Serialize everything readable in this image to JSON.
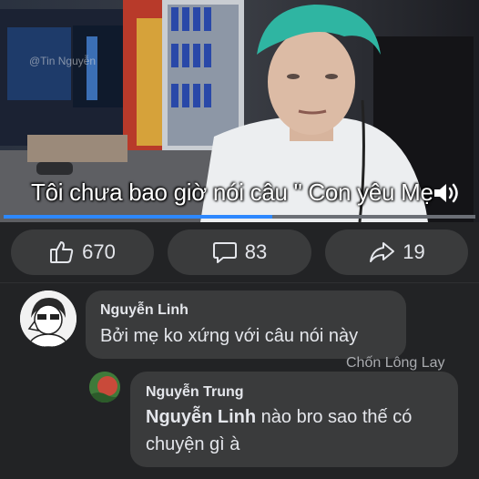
{
  "video": {
    "watermark": "@Tin Nguyễn",
    "subtitle": "Tôi chưa bao giờ nói câu \" Con yêu Mẹ",
    "progress_fraction": 0.57,
    "volume_icon": "speaker-icon"
  },
  "actions": {
    "like_count": "670",
    "comment_count": "83",
    "share_count": "19",
    "like_icon": "thumbs-up-icon",
    "comment_icon": "speech-bubble-icon",
    "share_icon": "share-arrow-icon"
  },
  "comments": [
    {
      "author": "Nguyễn Linh",
      "text": "Bởi mẹ ko xứng với câu nói này"
    }
  ],
  "reply": {
    "author": "Nguyễn Trung",
    "mention": "Nguyễn Linh",
    "text": " nào bro sao thế có chuyện gì à"
  },
  "channel_watermark": "Chốn Lông Lay",
  "colors": {
    "background": "#222325",
    "bubble": "#3a3b3c",
    "progress": "#2d88ff",
    "text": "#e4e6eb"
  }
}
